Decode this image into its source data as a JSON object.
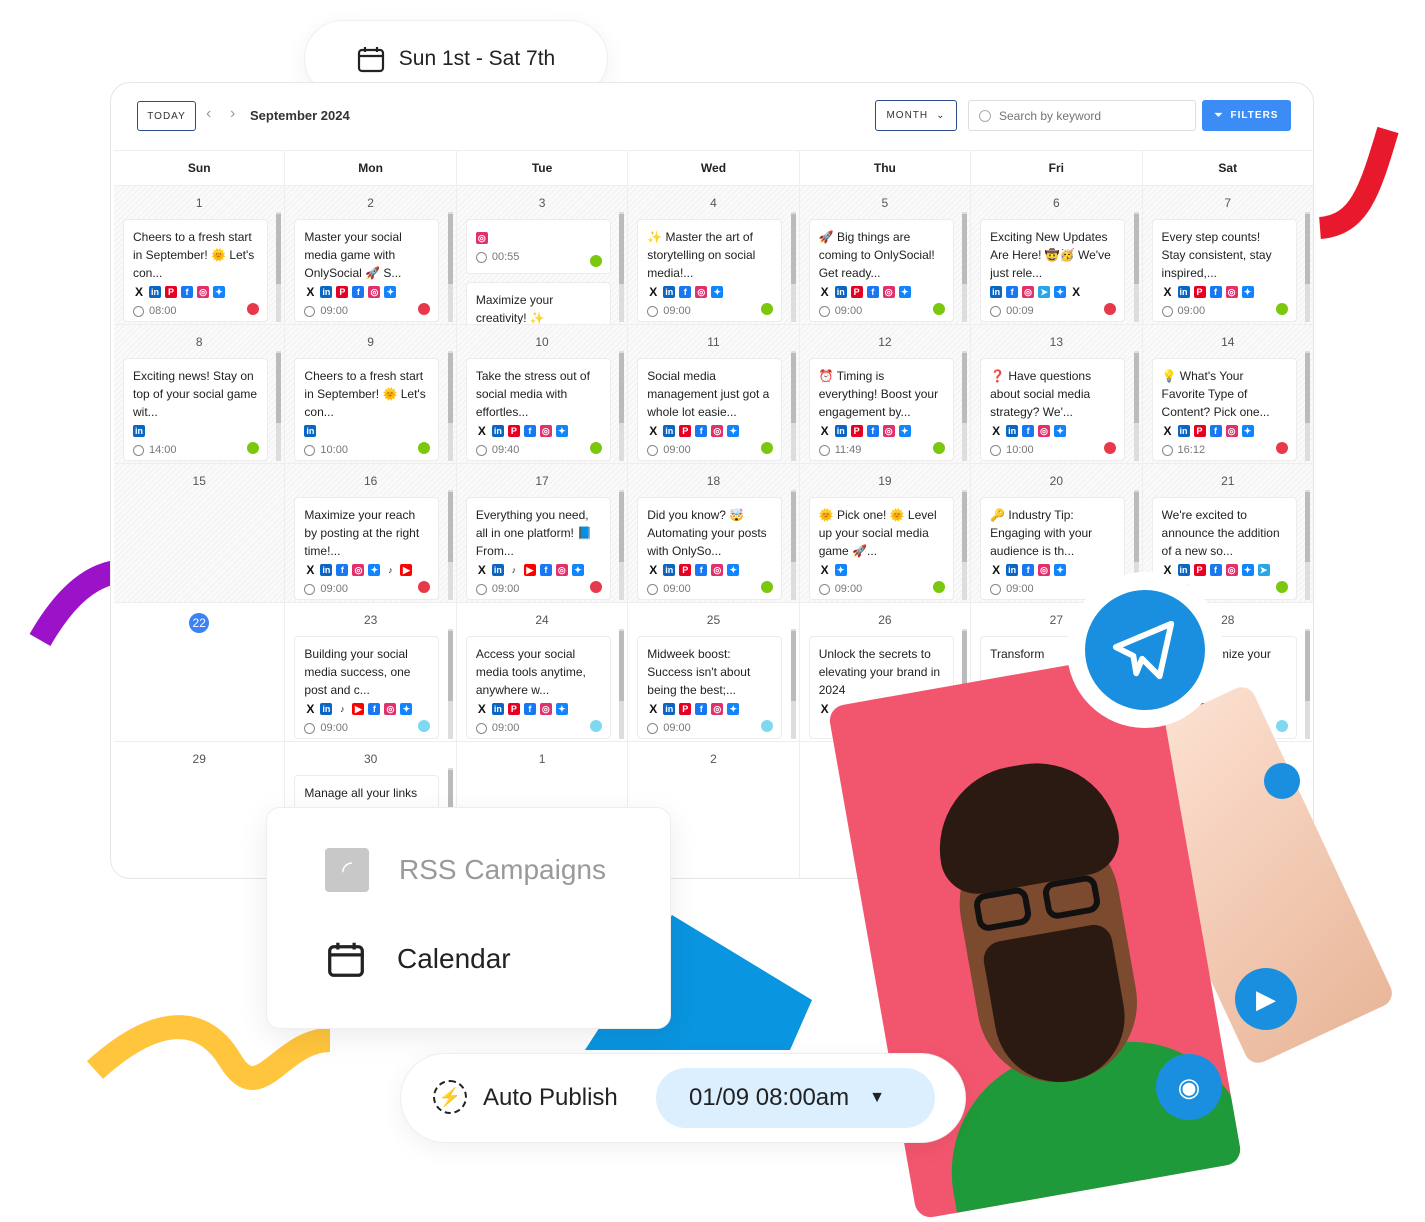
{
  "range_pill": {
    "label": "Sun 1st - Sat 7th",
    "icon": "calendar-icon"
  },
  "toolbar": {
    "today": "TODAY",
    "month_title": "September 2024",
    "view": "MONTH",
    "search_placeholder": "Search by keyword",
    "filters": "FILTERS"
  },
  "colors": {
    "accent": "#3b8df5",
    "green": "#7ac70c",
    "red": "#e8394a",
    "cyan": "#7dd8f0",
    "purple": "#9b12c9",
    "yellow": "#ffc53d",
    "brand_red": "#e8192c",
    "telegram": "#1a8fe0",
    "photo_bg": "#f2566e"
  },
  "weekdays": [
    "Sun",
    "Mon",
    "Tue",
    "Wed",
    "Thu",
    "Fri",
    "Sat"
  ],
  "weeks": [
    [
      {
        "day": "1",
        "posts": [
          {
            "text": "Cheers to a fresh start in September! 🌞 Let's con...",
            "icons": [
              "x",
              "li",
              "pi",
              "fb",
              "ig",
              "bs"
            ],
            "time": "08:00",
            "status": "red"
          }
        ]
      },
      {
        "day": "2",
        "posts": [
          {
            "text": "Master your social media game with OnlySocial 🚀 S...",
            "icons": [
              "x",
              "li",
              "pi",
              "fb",
              "ig",
              "bs"
            ],
            "time": "09:00",
            "status": "red"
          }
        ]
      },
      {
        "day": "3",
        "posts": [
          {
            "text": "",
            "icons": [
              "ig"
            ],
            "time": "00:55",
            "status": "green",
            "short": true
          },
          {
            "text": "Maximize your creativity! ✨",
            "icons": [],
            "time": "",
            "status": ""
          }
        ]
      },
      {
        "day": "4",
        "posts": [
          {
            "text": "✨ Master the art of storytelling on social media!...",
            "icons": [
              "x",
              "li",
              "fb",
              "ig",
              "bs"
            ],
            "time": "09:00",
            "status": "green"
          }
        ]
      },
      {
        "day": "5",
        "posts": [
          {
            "text": "🚀 Big things are coming to OnlySocial! Get ready...",
            "icons": [
              "x",
              "li",
              "pi",
              "fb",
              "ig",
              "bs"
            ],
            "time": "09:00",
            "status": "green"
          }
        ]
      },
      {
        "day": "6",
        "posts": [
          {
            "text": "Exciting New Updates Are Here! 🤠🥳 We've just rele...",
            "icons": [
              "li",
              "fb",
              "ig",
              "tg",
              "bs",
              "x"
            ],
            "time": "00:09",
            "status": "red"
          }
        ]
      },
      {
        "day": "7",
        "posts": [
          {
            "text": "Every step counts! Stay consistent, stay inspired,...",
            "icons": [
              "x",
              "li",
              "pi",
              "fb",
              "ig",
              "bs"
            ],
            "time": "09:00",
            "status": "green"
          }
        ]
      }
    ],
    [
      {
        "day": "8",
        "posts": [
          {
            "text": "Exciting news! Stay on top of your social game wit...",
            "icons": [
              "li"
            ],
            "time": "14:00",
            "status": "green"
          }
        ]
      },
      {
        "day": "9",
        "posts": [
          {
            "text": "Cheers to a fresh start in September! 🌞 Let's con...",
            "icons": [
              "li"
            ],
            "time": "10:00",
            "status": "green"
          }
        ]
      },
      {
        "day": "10",
        "posts": [
          {
            "text": "Take the stress out of social media with effortles...",
            "icons": [
              "x",
              "li",
              "pi",
              "fb",
              "ig",
              "bs"
            ],
            "time": "09:40",
            "status": "green"
          }
        ]
      },
      {
        "day": "11",
        "posts": [
          {
            "text": "Social media management just got a whole lot easie...",
            "icons": [
              "x",
              "li",
              "pi",
              "fb",
              "ig",
              "bs"
            ],
            "time": "09:00",
            "status": "green"
          }
        ]
      },
      {
        "day": "12",
        "posts": [
          {
            "text": "⏰ Timing is everything! Boost your engagement by...",
            "icons": [
              "x",
              "li",
              "pi",
              "fb",
              "ig",
              "bs"
            ],
            "time": "11:49",
            "status": "green"
          }
        ]
      },
      {
        "day": "13",
        "posts": [
          {
            "text": "❓ Have questions about social media strategy? We'...",
            "icons": [
              "x",
              "li",
              "fb",
              "ig",
              "bs"
            ],
            "time": "10:00",
            "status": "red"
          }
        ]
      },
      {
        "day": "14",
        "posts": [
          {
            "text": "💡 What's Your Favorite Type of Content? Pick one...",
            "icons": [
              "x",
              "li",
              "pi",
              "fb",
              "ig",
              "bs"
            ],
            "time": "16:12",
            "status": "red"
          }
        ]
      }
    ],
    [
      {
        "day": "15",
        "posts": []
      },
      {
        "day": "16",
        "posts": [
          {
            "text": "Maximize your reach by posting at the right time!...",
            "icons": [
              "x",
              "li",
              "fb",
              "ig",
              "bs",
              "tt",
              "yt"
            ],
            "time": "09:00",
            "status": "red"
          }
        ]
      },
      {
        "day": "17",
        "posts": [
          {
            "text": "Everything you need, all in one platform! 📘 From...",
            "icons": [
              "x",
              "li",
              "tt",
              "yt",
              "fb",
              "ig",
              "bs"
            ],
            "time": "09:00",
            "status": "red"
          }
        ]
      },
      {
        "day": "18",
        "posts": [
          {
            "text": "Did you know? 🤯 Automating your posts with OnlySo...",
            "icons": [
              "x",
              "li",
              "pi",
              "fb",
              "ig",
              "bs"
            ],
            "time": "09:00",
            "status": "green"
          }
        ]
      },
      {
        "day": "19",
        "posts": [
          {
            "text": "🌞 Pick one! 🌞 Level up your social media game 🚀...",
            "icons": [
              "x",
              "bs"
            ],
            "time": "09:00",
            "status": "green"
          }
        ]
      },
      {
        "day": "20",
        "posts": [
          {
            "text": "🔑 Industry Tip: Engaging with your audience is th...",
            "icons": [
              "x",
              "li",
              "fb",
              "ig",
              "bs"
            ],
            "time": "09:00",
            "status": ""
          }
        ]
      },
      {
        "day": "21",
        "posts": [
          {
            "text": "We're excited to announce the addition of a new so...",
            "icons": [
              "x",
              "li",
              "pi",
              "fb",
              "ig",
              "bs",
              "tg"
            ],
            "time": "42",
            "status": "green"
          }
        ]
      }
    ],
    [
      {
        "day": "22",
        "today": true,
        "posts": []
      },
      {
        "day": "23",
        "posts": [
          {
            "text": "Building your social media success, one post and c...",
            "icons": [
              "x",
              "li",
              "tt",
              "yt",
              "fb",
              "ig",
              "bs"
            ],
            "time": "09:00",
            "status": "cyan"
          }
        ]
      },
      {
        "day": "24",
        "posts": [
          {
            "text": "Access your social media tools anytime, anywhere w...",
            "icons": [
              "x",
              "li",
              "pi",
              "fb",
              "ig",
              "bs"
            ],
            "time": "09:00",
            "status": "cyan"
          }
        ]
      },
      {
        "day": "25",
        "posts": [
          {
            "text": "Midweek boost: Success isn't about being the best;...",
            "icons": [
              "x",
              "li",
              "pi",
              "fb",
              "ig",
              "bs"
            ],
            "time": "09:00",
            "status": "cyan"
          }
        ]
      },
      {
        "day": "26",
        "posts": [
          {
            "text": "Unlock the secrets to elevating your brand in 2024",
            "icons": [
              "x"
            ],
            "time": "",
            "status": ""
          }
        ]
      },
      {
        "day": "27",
        "posts": [
          {
            "text": "Transform",
            "icons": [],
            "time": "",
            "status": ""
          }
        ]
      },
      {
        "day": "28",
        "posts": [
          {
            "text": "...sions ...timize your ...d...",
            "icons": [
              "yt",
              "fb",
              "ig",
              "bs"
            ],
            "time": "",
            "status": "cyan"
          }
        ]
      }
    ],
    [
      {
        "day": "29",
        "posts": []
      },
      {
        "day": "30",
        "posts": [
          {
            "text": "Manage all your links",
            "icons": [],
            "time": "",
            "status": ""
          }
        ]
      },
      {
        "day": "1",
        "posts": []
      },
      {
        "day": "2",
        "posts": []
      },
      {
        "day": "",
        "posts": []
      },
      {
        "day": "",
        "posts": []
      },
      {
        "day": "",
        "posts": []
      }
    ]
  ],
  "menu": {
    "items": [
      {
        "label": "RSS Campaigns",
        "icon": "rss-icon"
      },
      {
        "label": "Calendar",
        "icon": "calendar-icon"
      }
    ]
  },
  "auto_publish": {
    "label": "Auto Publish",
    "icon": "lightning-icon",
    "datetime": "01/09 08:00am"
  }
}
